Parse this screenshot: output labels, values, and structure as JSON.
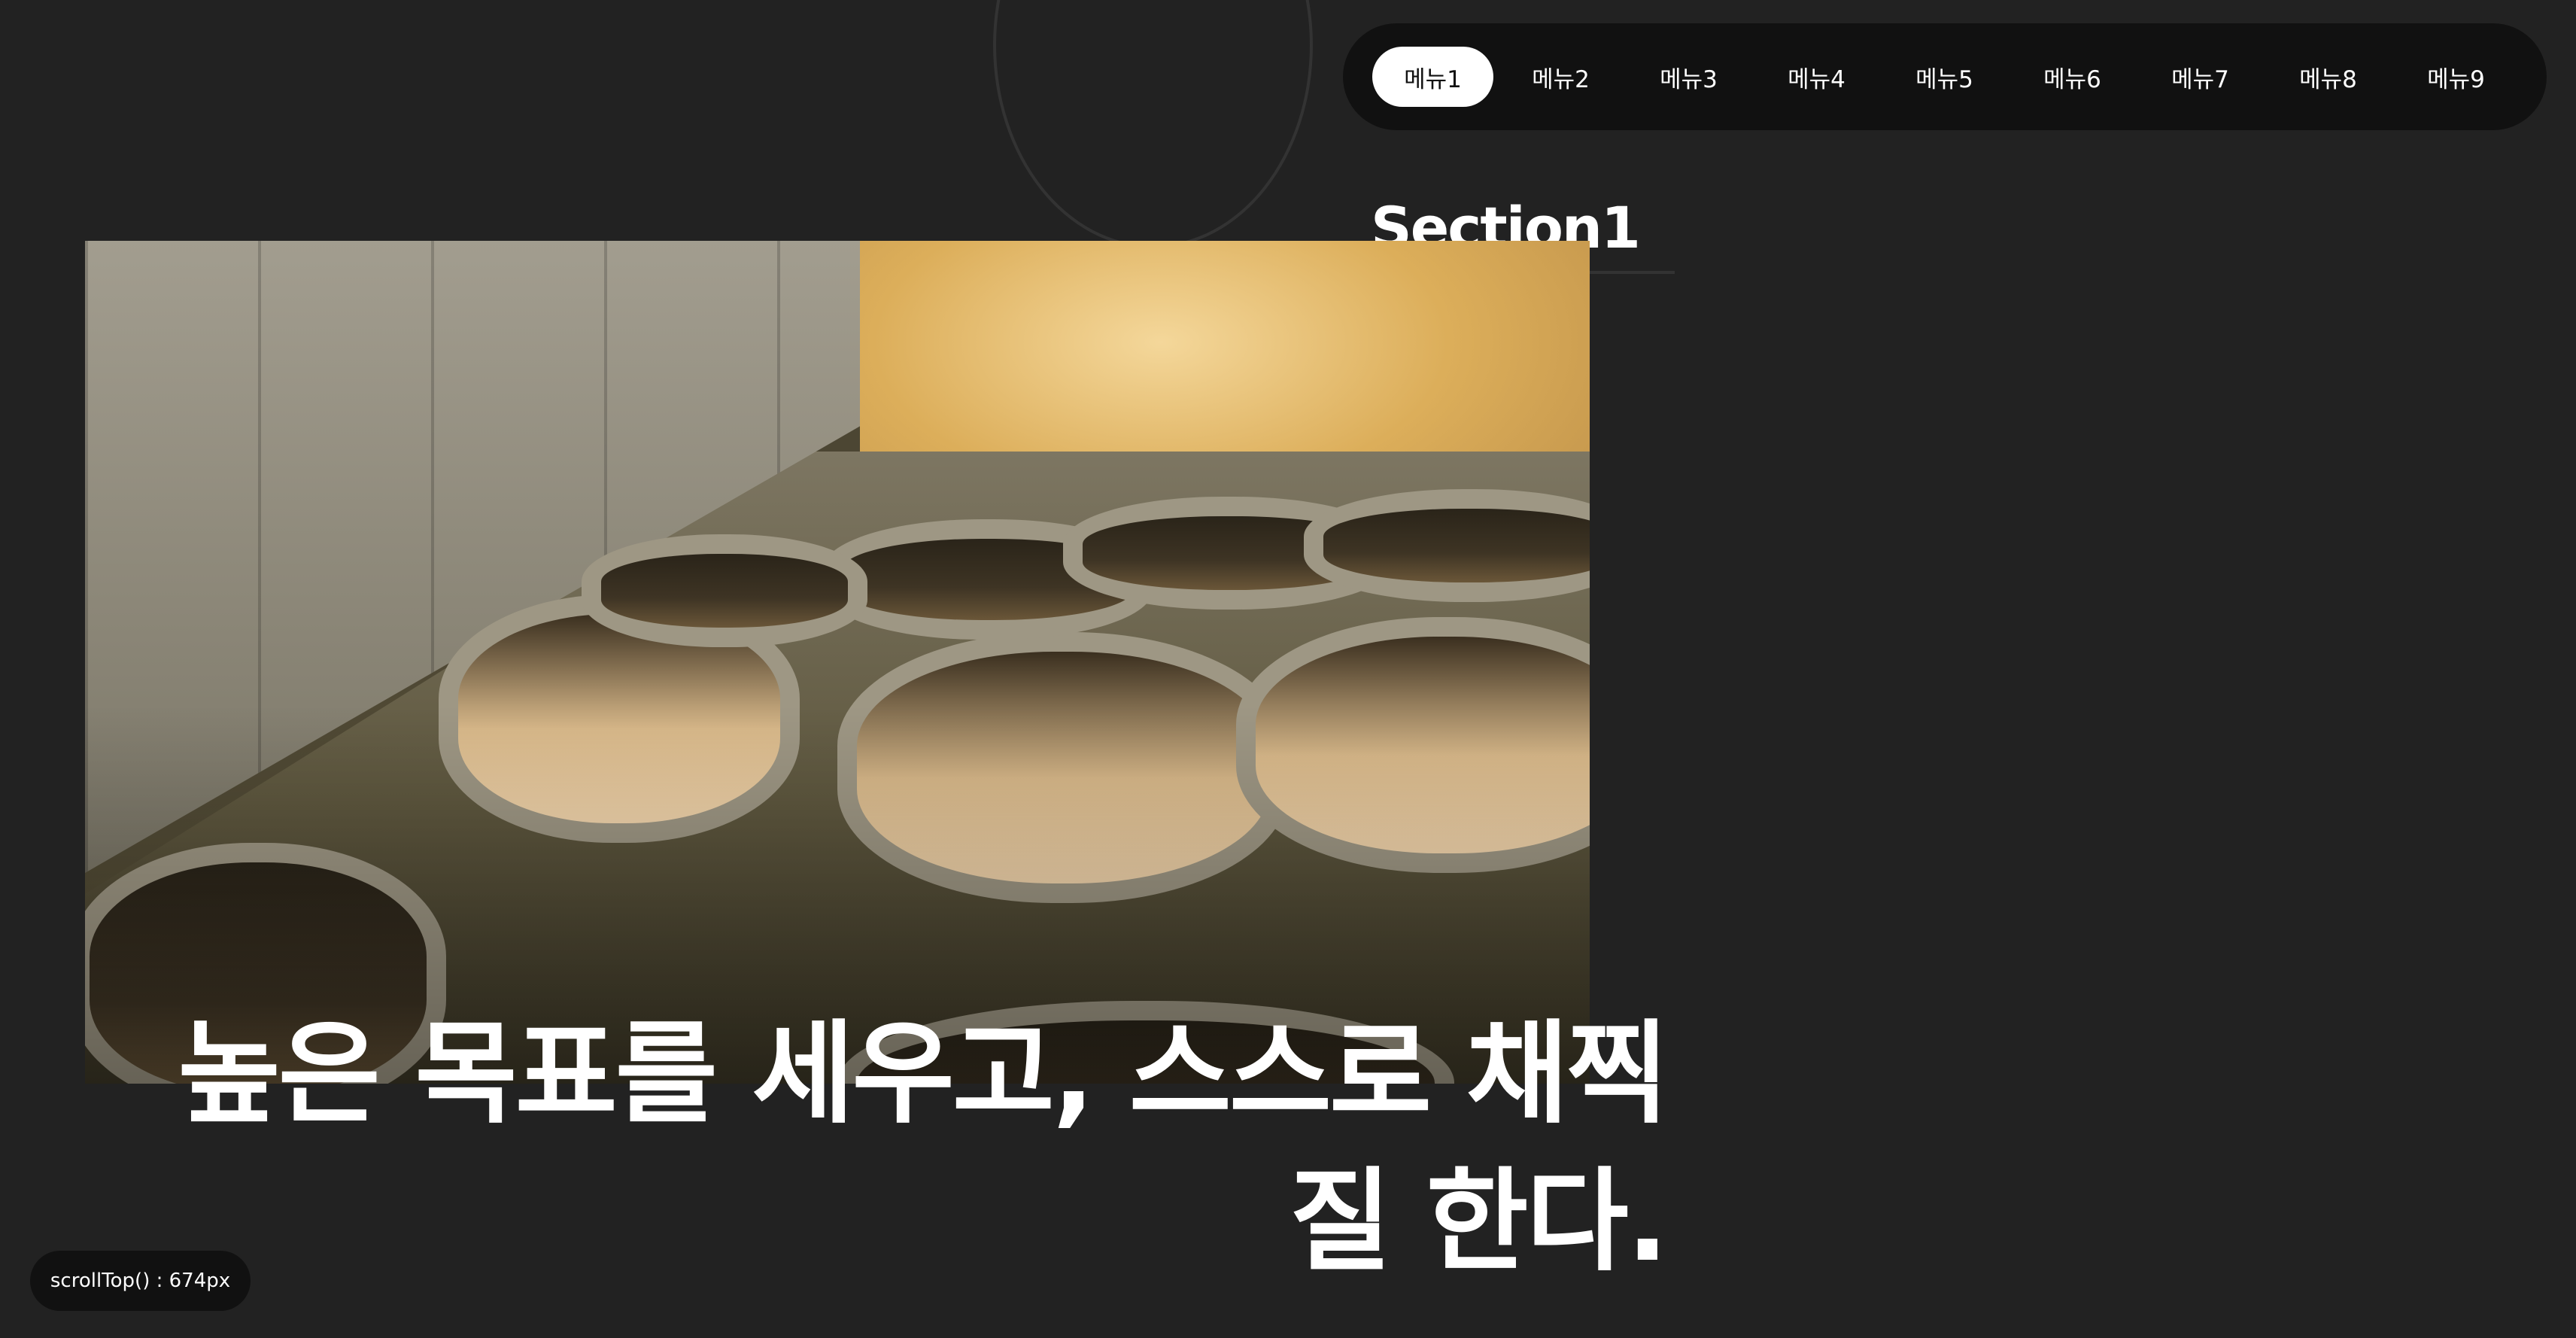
{
  "nav": {
    "items": [
      {
        "label": "메뉴1",
        "active": true
      },
      {
        "label": "메뉴2",
        "active": false
      },
      {
        "label": "메뉴3",
        "active": false
      },
      {
        "label": "메뉴4",
        "active": false
      },
      {
        "label": "메뉴5",
        "active": false
      },
      {
        "label": "메뉴6",
        "active": false
      },
      {
        "label": "메뉴7",
        "active": false
      },
      {
        "label": "메뉴8",
        "active": false
      },
      {
        "label": "메뉴9",
        "active": false
      }
    ]
  },
  "section": {
    "title": "Section1"
  },
  "hero": {
    "headline": "높은 목표를 세우고, 스스로 채찍질 한다."
  },
  "status": {
    "scroll_label": "scrollTop() : 674px"
  },
  "colors": {
    "background": "#222222",
    "nav_background": "#111111",
    "active_pill": "#ffffff",
    "text": "#ffffff"
  }
}
